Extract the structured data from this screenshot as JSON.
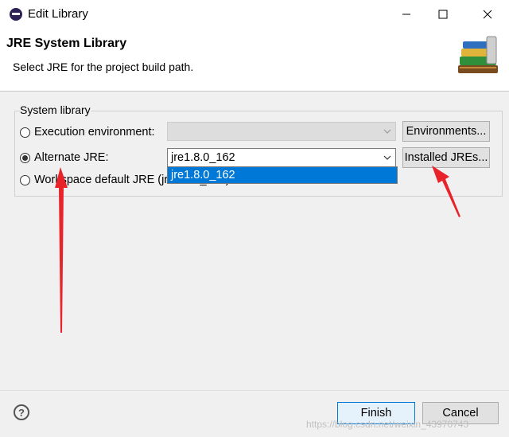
{
  "window": {
    "title": "Edit Library",
    "icon": "eclipse-app-icon"
  },
  "header": {
    "title": "JRE System Library",
    "description": "Select JRE for the project build path.",
    "icon": "library-books-icon"
  },
  "system_library": {
    "group_label": "System library",
    "options": [
      {
        "label": "Execution environment:",
        "checked": false,
        "combo_value": "",
        "combo_enabled": false,
        "button_label": "Environments..."
      },
      {
        "label": "Alternate JRE:",
        "checked": true,
        "combo_value": "jre1.8.0_162",
        "combo_enabled": true,
        "button_label": "Installed JREs..."
      },
      {
        "label": "Workspace default JRE (jre1.8.0_162)",
        "checked": false
      }
    ],
    "dropdown": {
      "items": [
        "jre1.8.0_162"
      ],
      "highlighted": 0
    }
  },
  "footer": {
    "help_icon": "?",
    "finish_label": "Finish",
    "cancel_label": "Cancel"
  },
  "watermark": "https://blog.csdn.net/weixin_43970743",
  "colors": {
    "selection": "#0078d7",
    "annotation_arrow": "#e8232a"
  }
}
